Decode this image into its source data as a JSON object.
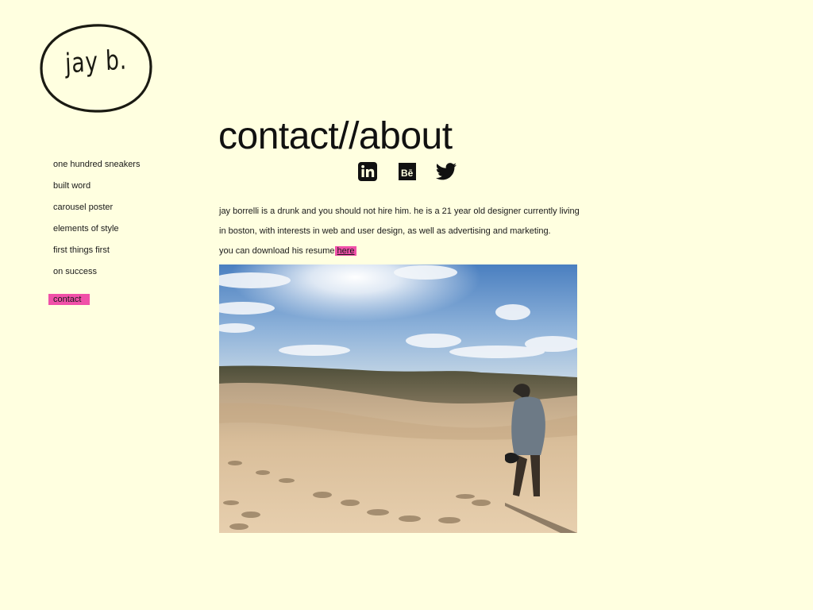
{
  "logo": {
    "text": "jay b.",
    "icon": "hand-drawn-circle-logo"
  },
  "nav": {
    "items": [
      {
        "label": "one hundred sneakers"
      },
      {
        "label": "built word"
      },
      {
        "label": "carousel poster"
      },
      {
        "label": "elements of style"
      },
      {
        "label": "first things first"
      },
      {
        "label": "on success"
      }
    ],
    "active": {
      "label": "contact"
    }
  },
  "main": {
    "title": "contact//about",
    "social": [
      {
        "icon": "linkedin-icon"
      },
      {
        "icon": "behance-icon"
      },
      {
        "icon": "twitter-icon"
      }
    ],
    "bio": {
      "line1": "jay borrelli is a drunk and you should not hire him. he is a 21 year old designer currently living",
      "line2": "in boston, with interests in web and user design, as well as advertising and marketing.",
      "line3_prefix": "you can download his resume",
      "resume_link": "here"
    },
    "photo": {
      "subject": "person standing on sand dunes under a sunny sky"
    }
  },
  "colors": {
    "background": "#ffffe0",
    "accent": "#f050a8",
    "text": "#1a1a1a"
  }
}
